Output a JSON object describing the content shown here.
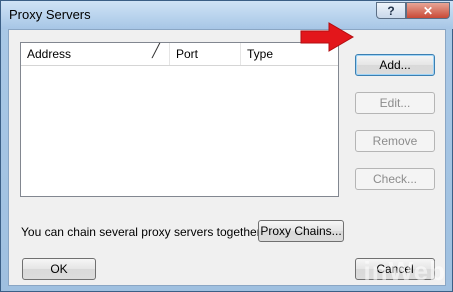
{
  "window": {
    "title": "Proxy Servers"
  },
  "titlebar_buttons": {
    "help": "?",
    "close": "✕"
  },
  "list": {
    "columns": [
      "Address",
      "Port",
      "Type"
    ],
    "rows": []
  },
  "buttons": {
    "add": "Add...",
    "edit": "Edit...",
    "remove": "Remove",
    "check": "Check...",
    "proxy_chains": "Proxy Chains...",
    "ok": "OK",
    "cancel": "Cancel"
  },
  "chain_text": "You can chain several proxy servers together:",
  "watermark": "inWeb",
  "colors": {
    "arrow": "#e3161b",
    "title_bar": "#bcd6ee"
  }
}
